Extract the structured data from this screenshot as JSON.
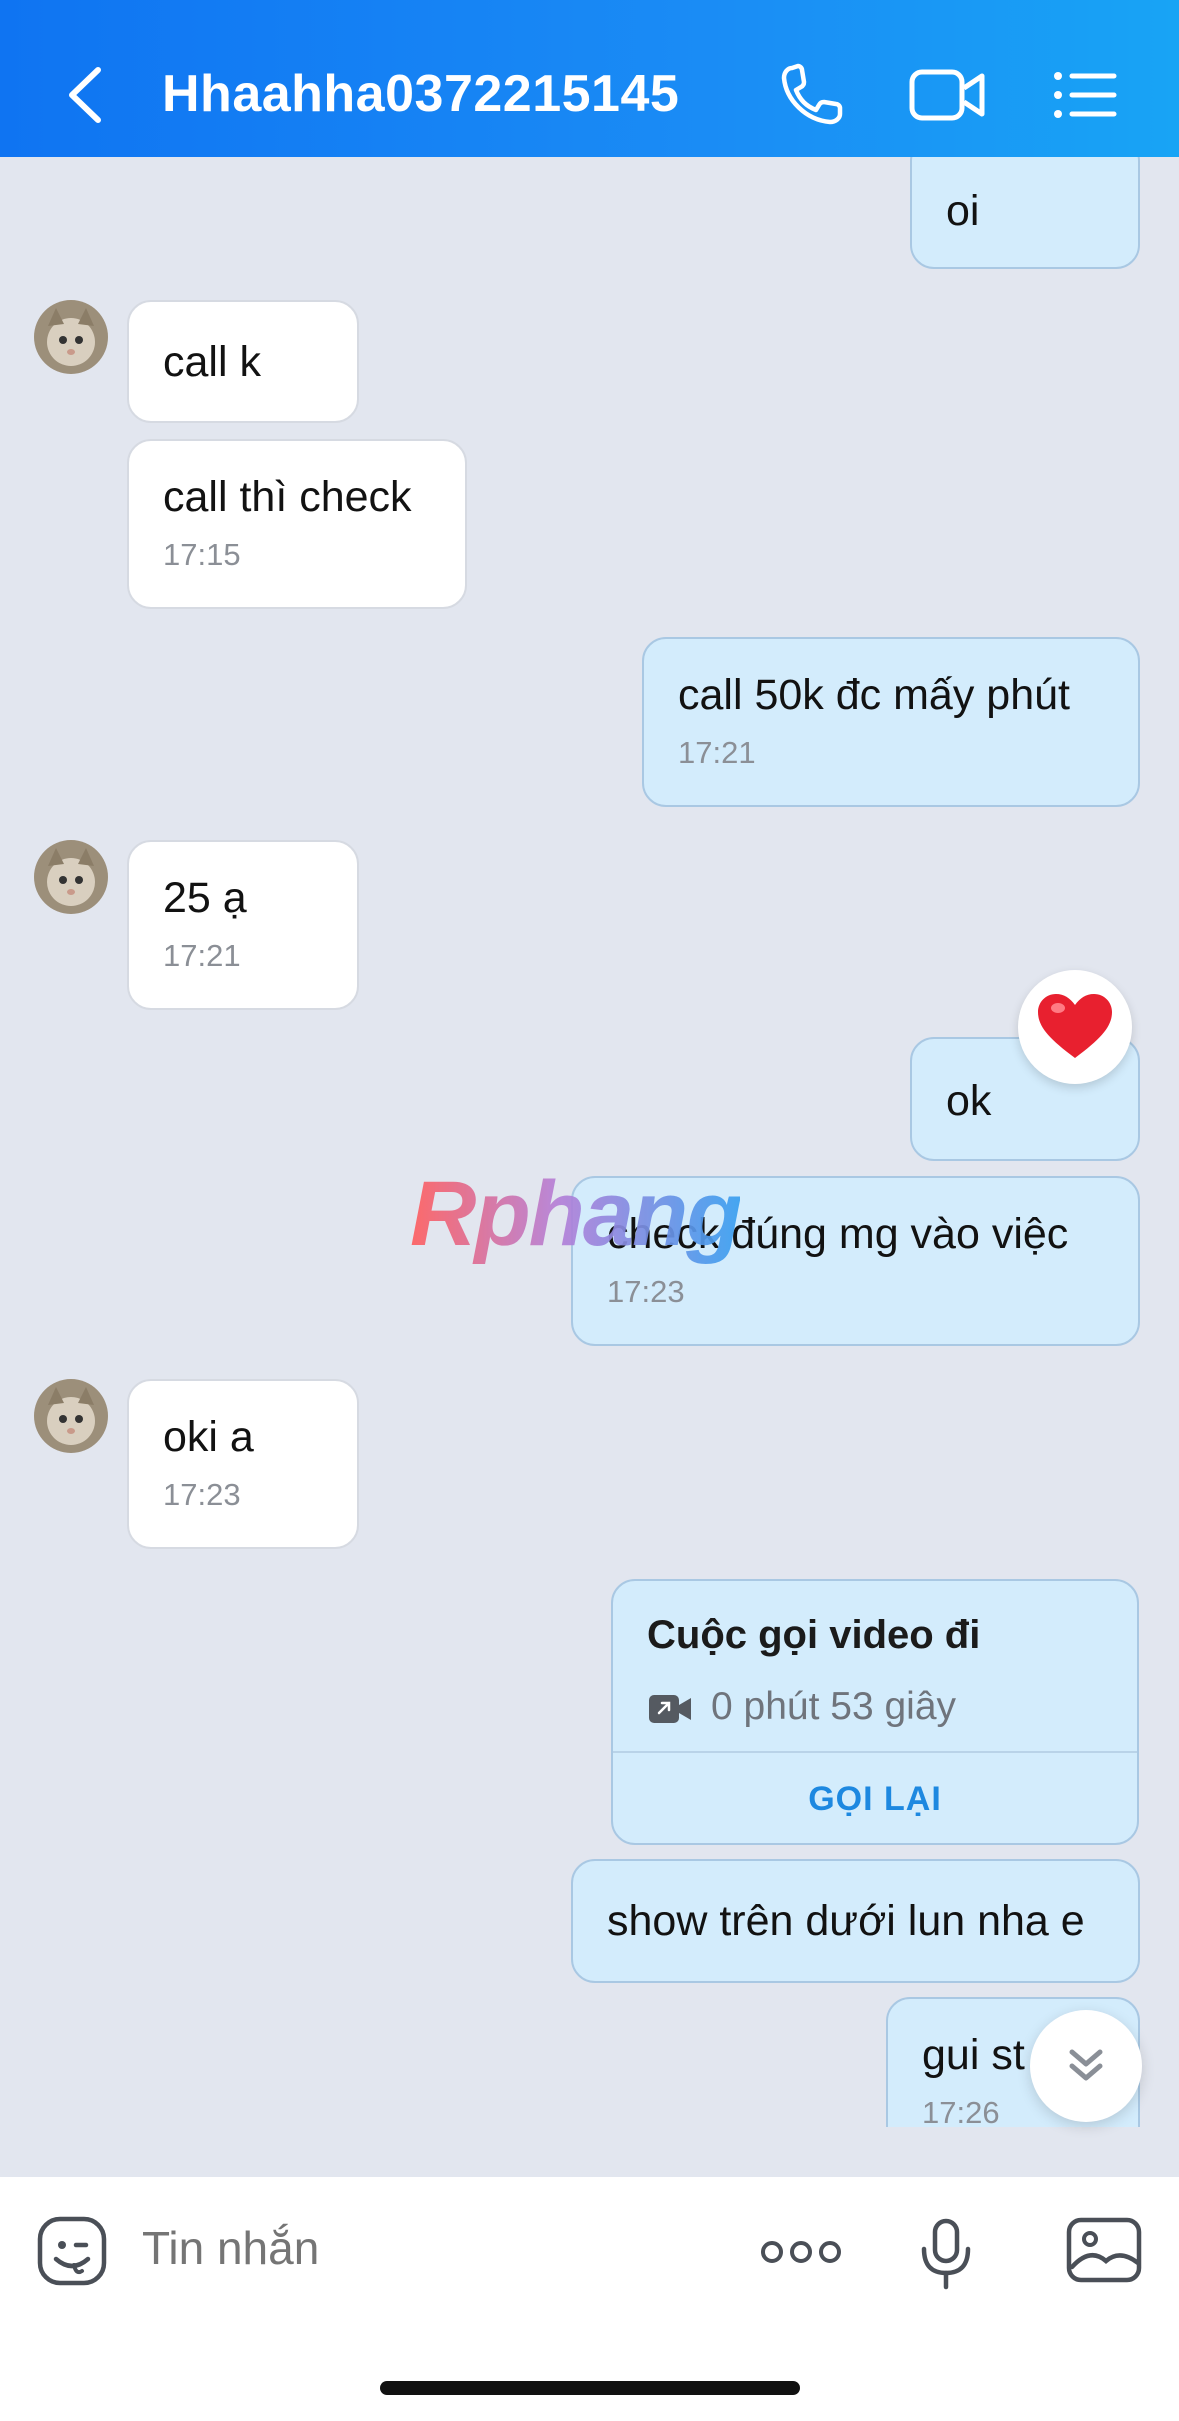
{
  "header": {
    "title": "Hhaahha0372215145",
    "back_icon": "chevron-left-icon",
    "call_icon": "phone-icon",
    "video_icon": "video-camera-icon",
    "menu_icon": "list-menu-icon",
    "bg_color": "#1a8cf5"
  },
  "messages": [
    {
      "dir": "out",
      "text": "oi",
      "time": ""
    },
    {
      "dir": "in",
      "text": "call k",
      "time": ""
    },
    {
      "dir": "in",
      "text": "call thì check",
      "time": "17:15"
    },
    {
      "dir": "out",
      "text": "call 50k đc mấy phút",
      "time": "17:21"
    },
    {
      "dir": "in",
      "text": "25 ạ",
      "time": "17:21"
    },
    {
      "dir": "out",
      "text": "ok",
      "time": "",
      "reaction": "heart"
    },
    {
      "dir": "out",
      "text": "check đúng mg vào việc",
      "time": "17:23"
    },
    {
      "dir": "in",
      "text": "oki a",
      "time": "17:23"
    },
    {
      "dir": "out",
      "text": "show trên dưới lun nha e",
      "time": ""
    },
    {
      "dir": "out",
      "text": "gui st",
      "time": "17:26"
    }
  ],
  "call_card": {
    "title": "Cuộc gọi video đi",
    "duration": "0 phút 53 giây",
    "action": "GỌI LẠI"
  },
  "watermark": "Rphang",
  "input": {
    "placeholder": "Tin nhắn",
    "emoji_icon": "sticker-icon",
    "more_icon": "more-dots-icon",
    "mic_icon": "microphone-icon",
    "image_icon": "image-icon"
  },
  "colors": {
    "chat_bg": "#e2e6ef",
    "outgoing_bubble": "#d3ecfc",
    "incoming_bubble": "#ffffff",
    "accent": "#1d88e0"
  }
}
